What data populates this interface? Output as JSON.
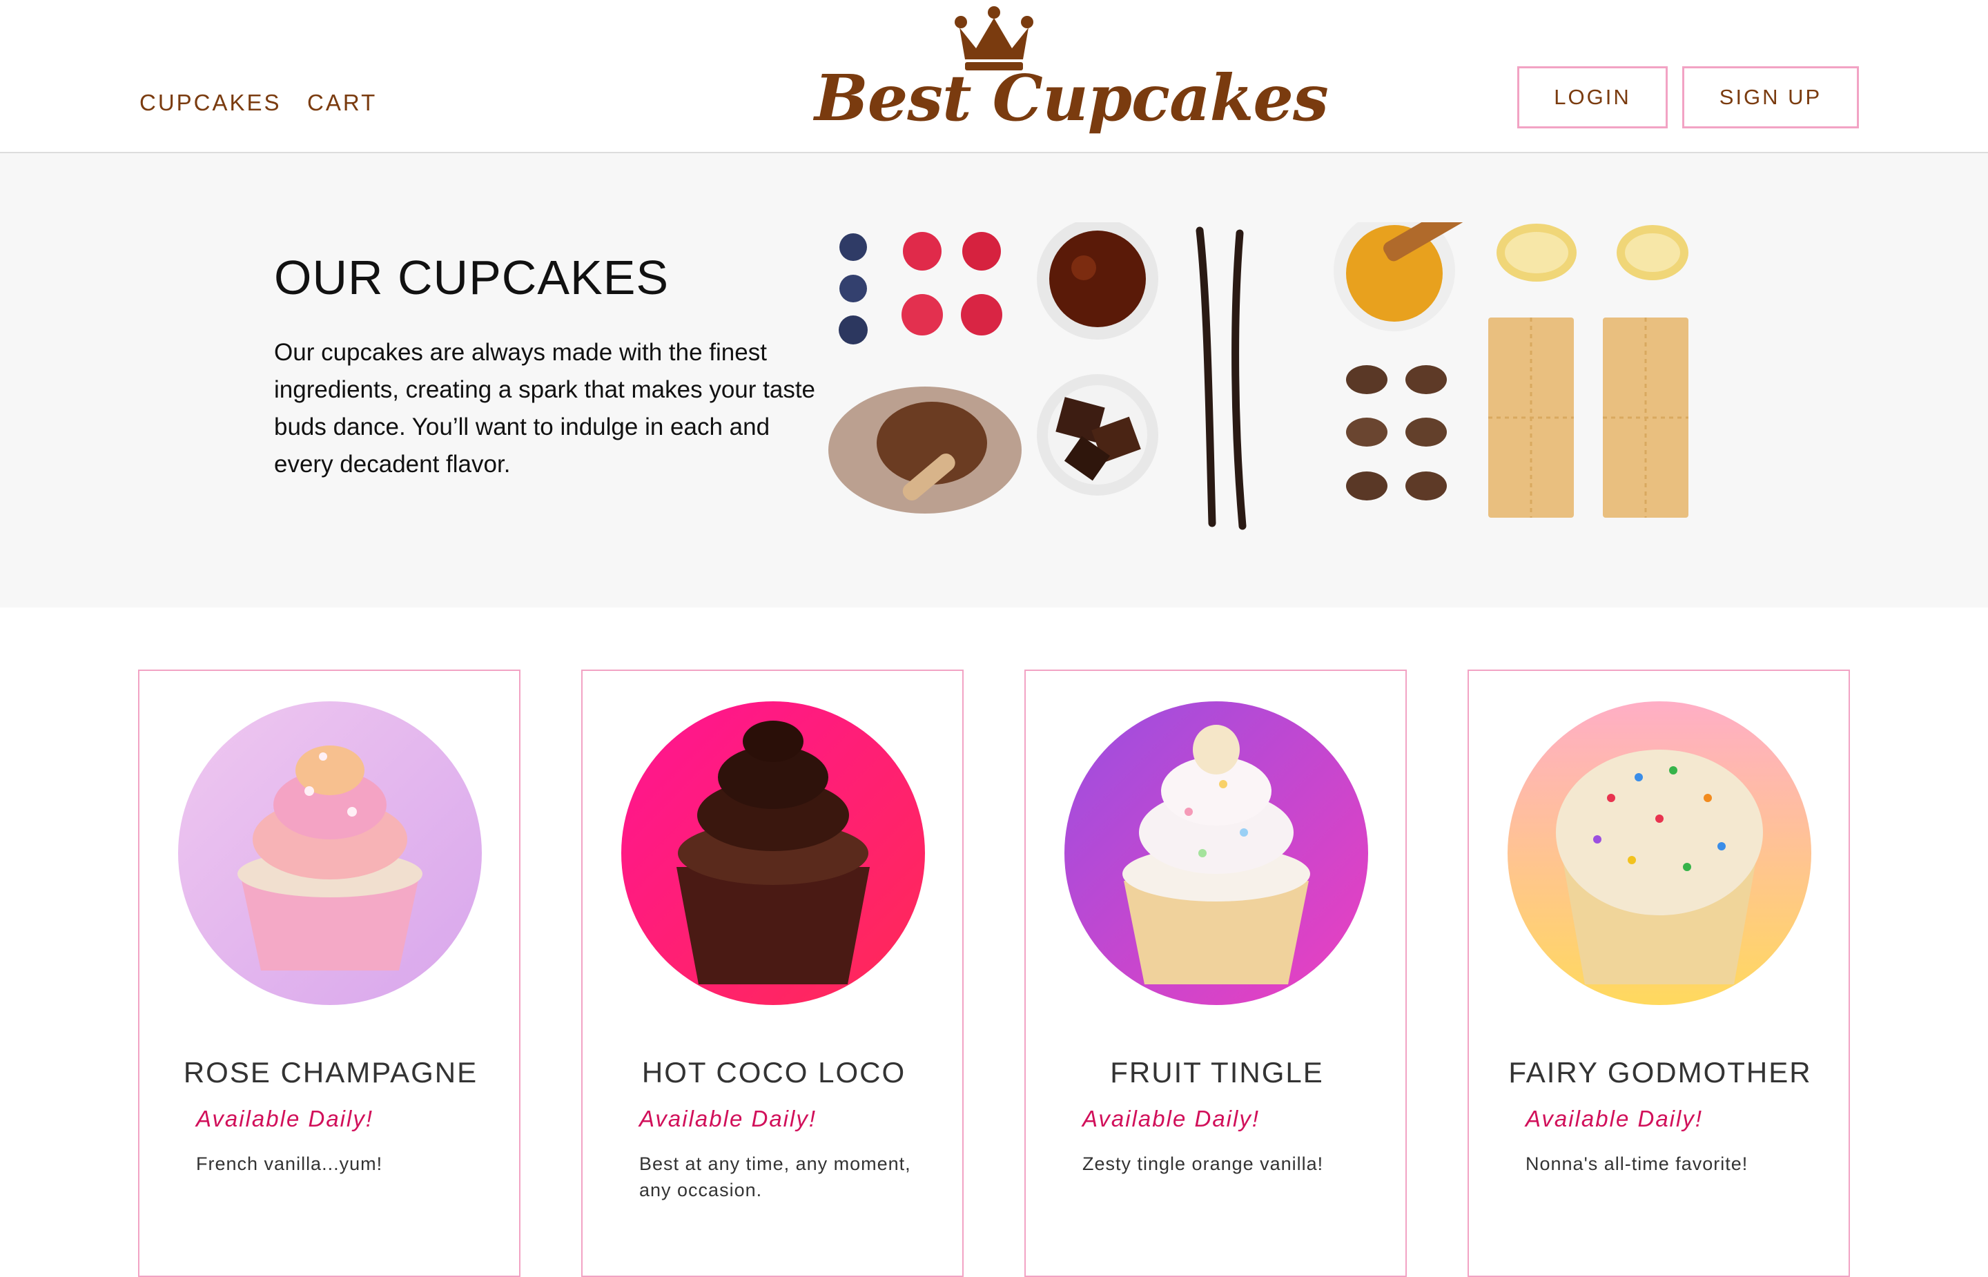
{
  "header": {
    "nav": [
      {
        "label": "CUPCAKES"
      },
      {
        "label": "CART"
      }
    ],
    "logo": {
      "text": "Best Cupcakes",
      "icon": "crown-icon",
      "color": "#7a3b0f"
    },
    "login_label": "LOGIN",
    "signup_label": "SIGN UP"
  },
  "hero": {
    "title": "OUR CUPCAKES",
    "text": "Our cupcakes are always made with the finest ingredients, creating a spark that makes your taste buds dance. You’ll want to indulge in each and every decadent flavor."
  },
  "cupcakes": [
    {
      "name": "ROSE CHAMPAGNE",
      "availability": "Available Daily!",
      "description": "French vanilla...yum!",
      "bg_from": "#e9c3ef",
      "bg_to": "#d9a8ec"
    },
    {
      "name": "HOT COCO LOCO",
      "availability": "Available Daily!",
      "description": "Best at any time, any moment, any occasion.",
      "bg_from": "#ff1493",
      "bg_to": "#ff2a5a"
    },
    {
      "name": "FRUIT TINGLE",
      "availability": "Available Daily!",
      "description": "Zesty tingle orange vanilla!",
      "bg_from": "#9b4fe0",
      "bg_to": "#e83fc2"
    },
    {
      "name": "FAIRY GODMOTHER",
      "availability": "Available Daily!",
      "description": "Nonna's all-time favorite!",
      "bg_from": "#ffaec3",
      "bg_to": "#ffd25e"
    }
  ],
  "colors": {
    "accent": "#d1105a",
    "border": "#f2a3c4",
    "brown": "#7a3b0f",
    "hero_bg": "#f7f7f7"
  }
}
